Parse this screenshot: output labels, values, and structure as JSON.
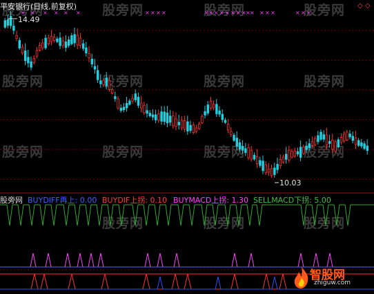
{
  "title": "平安银行(日线,前复权)",
  "watermark": "股旁网",
  "max_label": "14.49",
  "min_label": "10.03",
  "indicator": {
    "name": "股旁网",
    "items": [
      {
        "label": "BUYDIFF再上: 0.00",
        "color": "#4060ff"
      },
      {
        "label": "BUYDIF上拐: 0.10",
        "color": "#ff3b3b"
      },
      {
        "label": "BUYMACD上拐: 1.30",
        "color": "#ff40ff"
      },
      {
        "label": "SELLMACD下拐: 5.00",
        "color": "#3fbf3f"
      }
    ]
  },
  "logo": {
    "name": "智股网",
    "url": "zhiguw.com"
  },
  "corner_icons": "◇ ◇",
  "colors": {
    "up": "#ff3030",
    "down": "#20d0e0",
    "cross": "#ff40ff",
    "grid": "#7a0000"
  },
  "cross_marks": {
    "count": 28
  }
}
